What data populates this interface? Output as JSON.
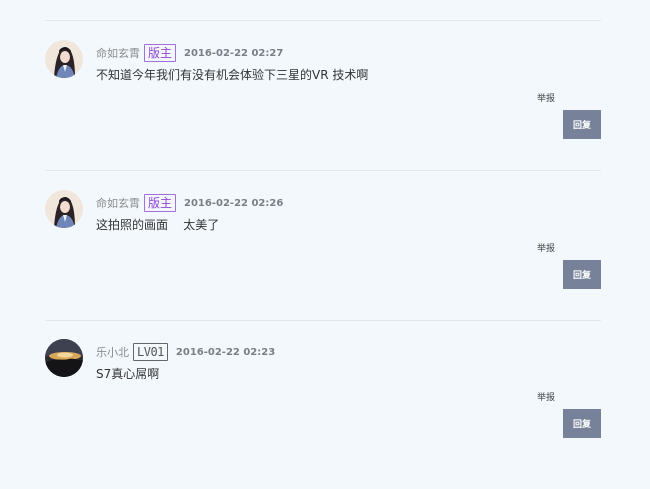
{
  "comments": [
    {
      "username": "命如玄霄",
      "badge": "版主",
      "time": "2016-02-22 02:27",
      "content": "不知道今年我们有没有机会体验下三星的VR 技术啊",
      "report": "举报",
      "reply": "回复"
    },
    {
      "username": "命如玄霄",
      "badge": "版主",
      "time": "2016-02-22 02:26",
      "content": "这拍照的画面    太美了",
      "report": "举报",
      "reply": "回复"
    },
    {
      "username": "乐小北",
      "badge": "LV01",
      "time": "2016-02-22 02:23",
      "content": "S7真心屌啊",
      "report": "举报",
      "reply": "回复"
    }
  ]
}
